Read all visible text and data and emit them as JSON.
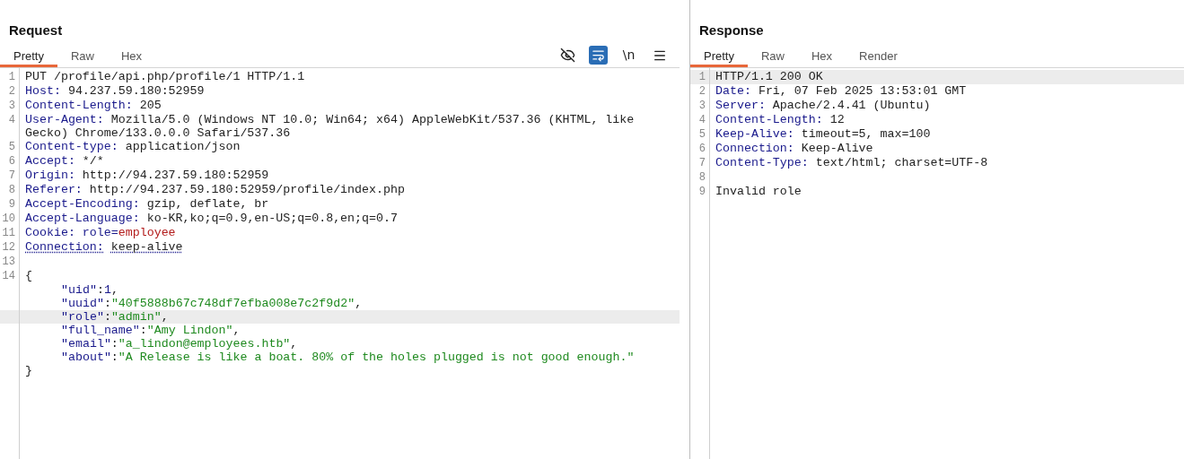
{
  "request": {
    "title": "Request",
    "tabs": [
      {
        "label": "Pretty",
        "selected": true
      },
      {
        "label": "Raw",
        "selected": false
      },
      {
        "label": "Hex",
        "selected": false
      }
    ],
    "toolbar": [
      {
        "kind": "eye-off",
        "selected": false
      },
      {
        "kind": "wrap",
        "selected": true
      },
      {
        "kind": "newline",
        "label": "\\n",
        "selected": false
      },
      {
        "kind": "menu",
        "selected": false
      }
    ],
    "lines": [
      {
        "number": "1",
        "highlighted": false,
        "flagged": false,
        "segments": [
          {
            "kind": "plain",
            "text": "PUT /profile/api.php/profile/1 HTTP/1.1"
          }
        ]
      },
      {
        "number": "2",
        "highlighted": false,
        "flagged": false,
        "segments": [
          {
            "kind": "name",
            "text": "Host:"
          },
          {
            "kind": "value",
            "text": "94.237.59.180:52959"
          }
        ]
      },
      {
        "number": "3",
        "highlighted": false,
        "flagged": false,
        "segments": [
          {
            "kind": "name",
            "text": "Content-Length:"
          },
          {
            "kind": "value",
            "text": "205"
          }
        ]
      },
      {
        "number": "4",
        "highlighted": false,
        "flagged": false,
        "segments": [
          {
            "kind": "name",
            "text": "User-Agent:"
          },
          {
            "kind": "value",
            "text": "Mozilla/5.0 (Windows NT 10.0; Win64; x64) AppleWebKit/537.36 (KHTML, like"
          }
        ],
        "continuation": "Gecko) Chrome/133.0.0.0 Safari/537.36"
      },
      {
        "number": "5",
        "highlighted": false,
        "flagged": false,
        "segments": [
          {
            "kind": "name",
            "text": "Content-type:"
          },
          {
            "kind": "value",
            "text": "application/json"
          }
        ]
      },
      {
        "number": "6",
        "highlighted": false,
        "flagged": false,
        "segments": [
          {
            "kind": "name",
            "text": "Accept:"
          },
          {
            "kind": "value",
            "text": "*/*"
          }
        ]
      },
      {
        "number": "7",
        "highlighted": false,
        "flagged": false,
        "segments": [
          {
            "kind": "name",
            "text": "Origin:"
          },
          {
            "kind": "value",
            "text": "http://94.237.59.180:52959"
          }
        ]
      },
      {
        "number": "8",
        "highlighted": false,
        "flagged": false,
        "segments": [
          {
            "kind": "name",
            "text": "Referer:"
          },
          {
            "kind": "value",
            "text": "http://94.237.59.180:52959/profile/index.php"
          }
        ]
      },
      {
        "number": "9",
        "highlighted": false,
        "flagged": false,
        "segments": [
          {
            "kind": "name",
            "text": "Accept-Encoding:"
          },
          {
            "kind": "value",
            "text": "gzip, deflate, br"
          }
        ]
      },
      {
        "number": "10",
        "highlighted": false,
        "flagged": false,
        "segments": [
          {
            "kind": "name",
            "text": "Accept-Language:"
          },
          {
            "kind": "value",
            "text": "ko-KR,ko;q=0.9,en-US;q=0.8,en;q=0.7"
          }
        ]
      },
      {
        "number": "11",
        "highlighted": false,
        "flagged": false,
        "segments": [
          {
            "kind": "name",
            "text": "Cookie:"
          },
          {
            "kind": "cookie-name",
            "text": "role="
          },
          {
            "kind": "cookie-value",
            "text": "employee"
          }
        ]
      },
      {
        "number": "12",
        "highlighted": false,
        "flagged": true,
        "segments": [
          {
            "kind": "name",
            "text": "Connection:"
          },
          {
            "kind": "value",
            "text": "keep-alive"
          }
        ]
      },
      {
        "number": "13",
        "highlighted": false
      },
      {
        "number": "14",
        "highlighted": false,
        "flagged": false,
        "segments": [
          {
            "kind": "punct",
            "text": "{"
          }
        ],
        "children": [
          {
            "highlighted": false,
            "flagged": false,
            "segments": [
              {
                "kind": "key",
                "text": "\"uid\""
              },
              {
                "kind": "punct",
                "text": ":"
              },
              {
                "kind": "number",
                "text": "1"
              },
              {
                "kind": "punct",
                "text": ","
              }
            ]
          },
          {
            "highlighted": false,
            "flagged": false,
            "segments": [
              {
                "kind": "key",
                "text": "\"uuid\""
              },
              {
                "kind": "punct",
                "text": ":"
              },
              {
                "kind": "string",
                "text": "\"40f5888b67c748df7efba008e7c2f9d2\""
              },
              {
                "kind": "punct",
                "text": ","
              }
            ]
          },
          {
            "highlighted": true,
            "flagged": false,
            "segments": [
              {
                "kind": "key",
                "text": "\"role\""
              },
              {
                "kind": "punct",
                "text": ":"
              },
              {
                "kind": "string",
                "text": "\"admin\""
              },
              {
                "kind": "punct",
                "text": ","
              }
            ]
          },
          {
            "highlighted": false,
            "flagged": false,
            "segments": [
              {
                "kind": "key",
                "text": "\"full_name\""
              },
              {
                "kind": "punct",
                "text": ":"
              },
              {
                "kind": "string",
                "text": "\"Amy Lindon\""
              },
              {
                "kind": "punct",
                "text": ","
              }
            ]
          },
          {
            "highlighted": false,
            "flagged": false,
            "segments": [
              {
                "kind": "key",
                "text": "\"email\""
              },
              {
                "kind": "punct",
                "text": ":"
              },
              {
                "kind": "string",
                "text": "\"a_lindon@employees.htb\""
              },
              {
                "kind": "punct",
                "text": ","
              }
            ]
          },
          {
            "highlighted": false,
            "flagged": false,
            "segments": [
              {
                "kind": "key",
                "text": "\"about\""
              },
              {
                "kind": "punct",
                "text": ":"
              },
              {
                "kind": "string",
                "text": "\"A Release is like a boat. 80% of the holes plugged is not good enough.\""
              }
            ]
          }
        ]
      },
      {
        "highlighted": false,
        "flagged": false,
        "segments": [
          {
            "kind": "punct",
            "text": "}"
          }
        ]
      }
    ]
  },
  "response": {
    "title": "Response",
    "tabs": [
      {
        "label": "Pretty",
        "selected": true
      },
      {
        "label": "Raw",
        "selected": false
      },
      {
        "label": "Hex",
        "selected": false
      },
      {
        "label": "Render",
        "selected": false
      }
    ],
    "lines": [
      {
        "number": "1",
        "highlighted": true,
        "flagged": false,
        "segments": [
          {
            "kind": "plain",
            "text": "HTTP/1.1 200 OK"
          }
        ]
      },
      {
        "number": "2",
        "highlighted": false,
        "flagged": false,
        "segments": [
          {
            "kind": "name",
            "text": "Date:"
          },
          {
            "kind": "value",
            "text": "Fri, 07 Feb 2025 13:53:01 GMT"
          }
        ]
      },
      {
        "number": "3",
        "highlighted": false,
        "flagged": false,
        "segments": [
          {
            "kind": "name",
            "text": "Server:"
          },
          {
            "kind": "value",
            "text": "Apache/2.4.41 (Ubuntu)"
          }
        ]
      },
      {
        "number": "4",
        "highlighted": false,
        "flagged": false,
        "segments": [
          {
            "kind": "name",
            "text": "Content-Length:"
          },
          {
            "kind": "value",
            "text": "12"
          }
        ]
      },
      {
        "number": "5",
        "highlighted": false,
        "flagged": false,
        "segments": [
          {
            "kind": "name",
            "text": "Keep-Alive:"
          },
          {
            "kind": "value",
            "text": "timeout=5, max=100"
          }
        ]
      },
      {
        "number": "6",
        "highlighted": false,
        "flagged": false,
        "segments": [
          {
            "kind": "name",
            "text": "Connection:"
          },
          {
            "kind": "value",
            "text": "Keep-Alive"
          }
        ]
      },
      {
        "number": "7",
        "highlighted": false,
        "flagged": false,
        "segments": [
          {
            "kind": "name",
            "text": "Content-Type:"
          },
          {
            "kind": "value",
            "text": "text/html; charset=UTF-8"
          }
        ]
      },
      {
        "number": "8",
        "highlighted": false
      },
      {
        "number": "9",
        "highlighted": false,
        "flagged": false,
        "segments": [
          {
            "kind": "plain",
            "text": "Invalid role"
          }
        ]
      }
    ]
  }
}
